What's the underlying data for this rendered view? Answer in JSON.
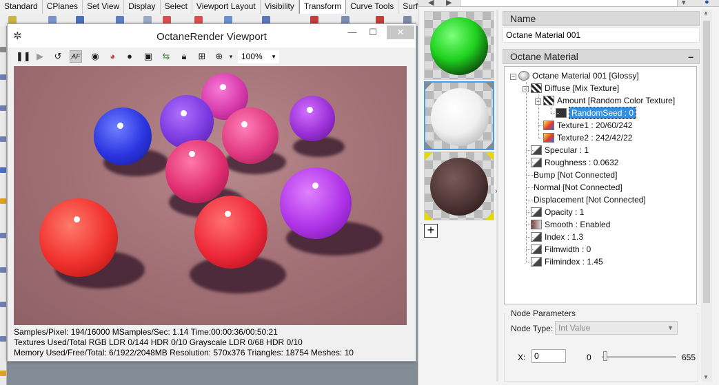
{
  "rhino_tabs": [
    "Standard",
    "CPlanes",
    "Set View",
    "Display",
    "Select",
    "Viewport Layout",
    "Visibility",
    "Transform",
    "Curve Tools",
    "Surfac"
  ],
  "rhino_active_tab": "Transform",
  "viewport": {
    "title": "OctaneRender Viewport",
    "toolbar": {
      "pause_icon": "pause-icon",
      "play_icon": "play-icon",
      "restart_icon": "restart-icon",
      "af_label": "AF",
      "zoom_value": "100%"
    },
    "status": {
      "line1": "Samples/Pixel: 194/16000  MSamples/Sec: 1.14  Time:00:00:36/00:50:21",
      "line2": "Textures Used/Total RGB LDR 0/144  HDR 0/10  Grayscale LDR 0/68  HDR 0/10",
      "line3": "Memory Used/Free/Total: 6/1922/2048MB  Resolution: 570x376  Triangles: 18754  Meshes:  10"
    },
    "render_bg_color": "#a47277"
  },
  "materials_panel": {
    "add_label": "+",
    "name_section": "Name",
    "name_value": "Octane Material 001",
    "material_section": "Octane Material",
    "collapse_label": "–",
    "tree": [
      {
        "label": "Octane Material 001  [Glossy]",
        "depth": 0,
        "toggle": "⊟"
      },
      {
        "label": "Diffuse  [Mix Texture]",
        "depth": 1,
        "toggle": "⊟"
      },
      {
        "label": "Amount  [Random Color Texture]",
        "depth": 2,
        "toggle": "⊟"
      },
      {
        "label": "RandomSeed : 0",
        "depth": 3,
        "toggle": "",
        "selected": true
      },
      {
        "label": "Texture1 : 20/60/242",
        "depth": 2,
        "toggle": ""
      },
      {
        "label": "Texture2 : 242/42/22",
        "depth": 2,
        "toggle": ""
      },
      {
        "label": "Specular : 1",
        "depth": 1,
        "toggle": ""
      },
      {
        "label": "Roughness : 0.0632",
        "depth": 1,
        "toggle": ""
      },
      {
        "label": "Bump  [Not Connected]",
        "depth": 1,
        "toggle": ""
      },
      {
        "label": "Normal  [Not Connected]",
        "depth": 1,
        "toggle": ""
      },
      {
        "label": "Displacement  [Not Connected]",
        "depth": 1,
        "toggle": ""
      },
      {
        "label": "Opacity : 1",
        "depth": 1,
        "toggle": ""
      },
      {
        "label": "Smooth : Enabled",
        "depth": 1,
        "toggle": ""
      },
      {
        "label": "Index : 1.3",
        "depth": 1,
        "toggle": ""
      },
      {
        "label": "Filmwidth : 0",
        "depth": 1,
        "toggle": ""
      },
      {
        "label": "Filmindex : 1.45",
        "depth": 1,
        "toggle": ""
      }
    ],
    "node_params": {
      "header": "Node Parameters",
      "node_type_label": "Node Type:",
      "node_type_value": "Int Value",
      "x_label": "X:",
      "x_value": "0",
      "slider_min": "0",
      "slider_max": "655",
      "slider_fraction": 0.0
    }
  },
  "colors": {
    "accent": "#3390e0",
    "swatch_green": "#1fd11f",
    "swatch_white": "#ffffff",
    "swatch_brown": "#5b3f3f"
  }
}
